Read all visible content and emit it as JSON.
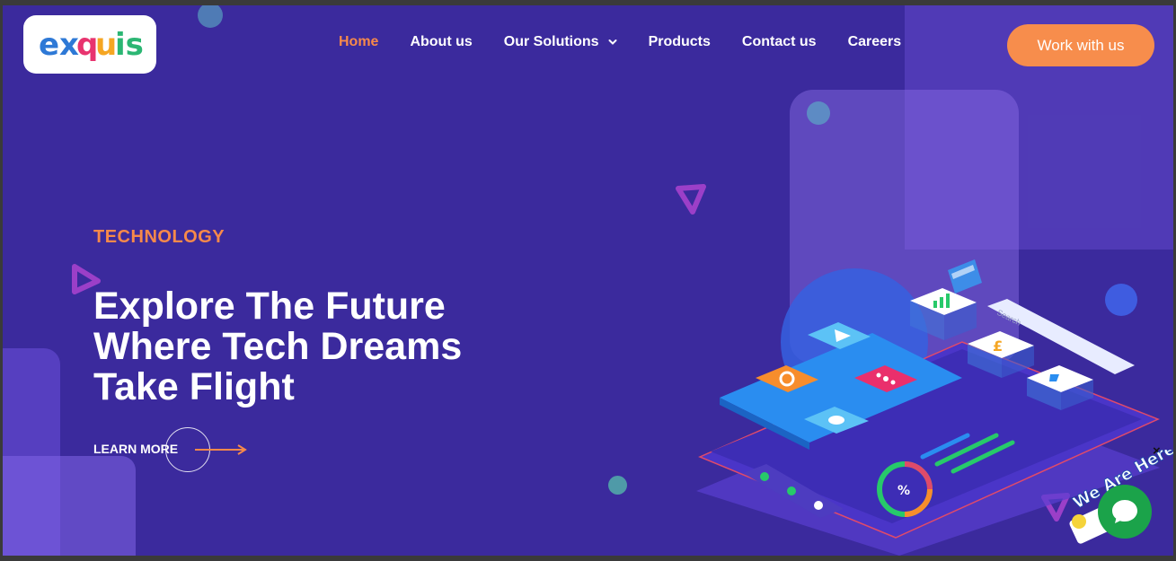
{
  "brand": {
    "logo_text": "exquis",
    "colors": {
      "background": "#3b2a9d",
      "accent": "#f78d4c",
      "active_nav": "#f7894a"
    }
  },
  "nav": {
    "items": [
      {
        "label": "Home",
        "active": true
      },
      {
        "label": "About us",
        "active": false
      },
      {
        "label": "Our Solutions",
        "active": false,
        "has_dropdown": true
      },
      {
        "label": "Products",
        "active": false
      },
      {
        "label": "Contact us",
        "active": false
      },
      {
        "label": "Careers",
        "active": false
      }
    ],
    "cta_label": "Work with us"
  },
  "hero": {
    "eyebrow": "TECHNOLOGY",
    "headline_lines": [
      "Explore The Future",
      "Where Tech Dreams",
      "Take Flight"
    ],
    "learn_more_label": "LEARN MORE"
  },
  "illustration": {
    "search_placeholder": "Search",
    "icons": [
      "play-icon",
      "gear-icon",
      "share-icon",
      "cloud-icon",
      "chart-icon",
      "pound-icon",
      "cart-icon",
      "percent-icon"
    ]
  },
  "chat_widget": {
    "badge_text": "We Are Here!",
    "close_label": "×",
    "icon": "chat-bubble-icon"
  }
}
